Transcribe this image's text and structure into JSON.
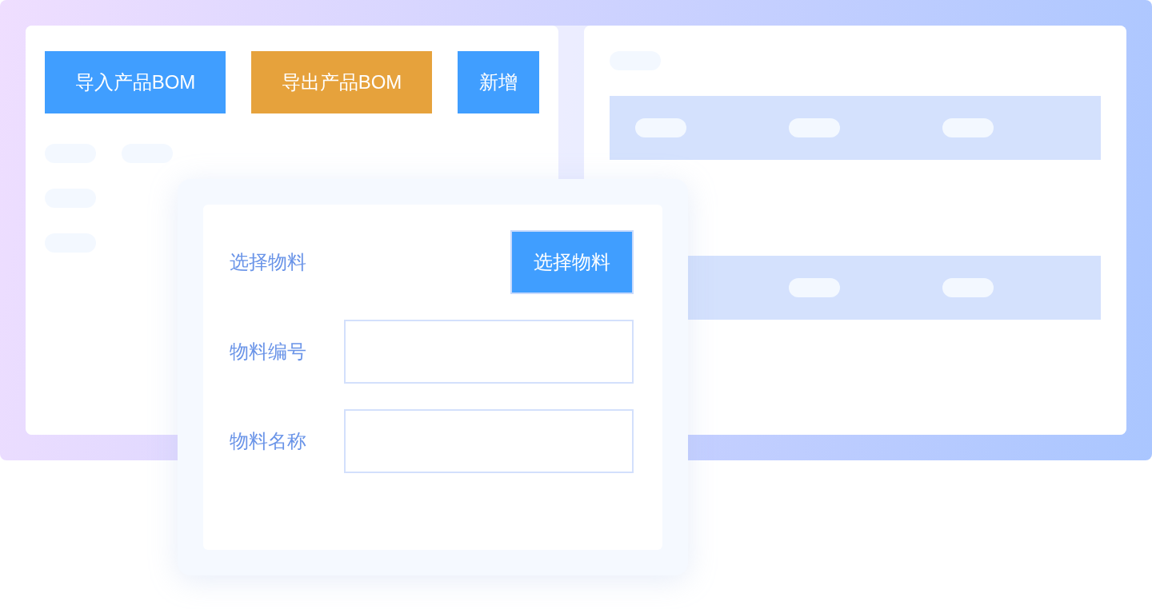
{
  "toolbar": {
    "buttons": [
      {
        "label": "导入产品BOM",
        "color": "#409eff"
      },
      {
        "label": "导出产品BOM",
        "color": "#e6a23c"
      },
      {
        "label": "新增",
        "color": "#409eff"
      }
    ]
  },
  "dialog": {
    "rows": [
      {
        "kind": "button",
        "label": "选择物料",
        "button": "选择物料"
      },
      {
        "kind": "input",
        "label": "物料编号"
      },
      {
        "kind": "input",
        "label": "物料名称"
      }
    ]
  }
}
